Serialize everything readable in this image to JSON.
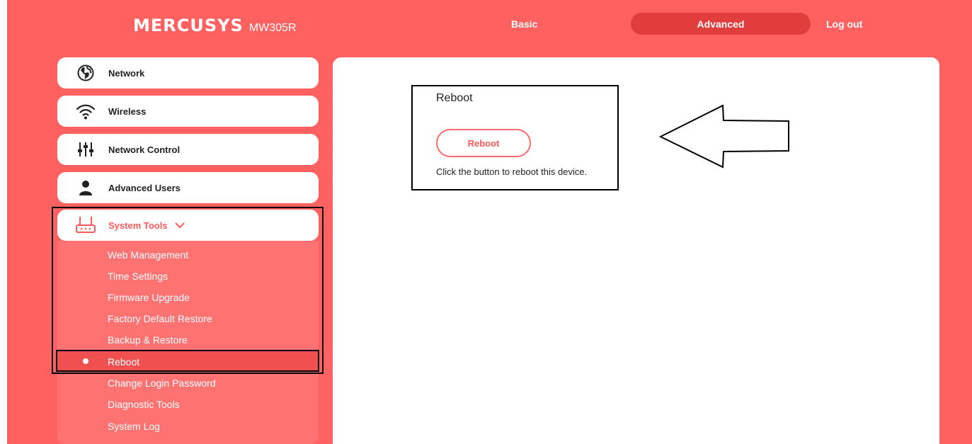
{
  "header": {
    "brand": "MERCUSYS",
    "model": "MW305R",
    "nav": {
      "basic": "Basic",
      "advanced": "Advanced",
      "logout": "Log out"
    }
  },
  "sidebar": {
    "items": [
      {
        "label": "Network",
        "icon": "globe-icon"
      },
      {
        "label": "Wireless",
        "icon": "wifi-icon"
      },
      {
        "label": "Network Control",
        "icon": "sliders-icon"
      },
      {
        "label": "Advanced Users",
        "icon": "user-icon"
      },
      {
        "label": "System Tools",
        "icon": "router-icon",
        "expanded": true
      }
    ],
    "subitems": [
      "Web Management",
      "Time Settings",
      "Firmware Upgrade",
      "Factory Default Restore",
      "Backup & Restore",
      "Reboot",
      "Change Login Password",
      "Diagnostic Tools",
      "System Log"
    ],
    "active_subitem": "Reboot"
  },
  "main": {
    "section_title": "Reboot",
    "button_label": "Reboot",
    "hint": "Click the button to reboot this device."
  },
  "colors": {
    "accent": "#ff6160",
    "active_nav": "#e23d3d",
    "sub_panel": "#ff7272",
    "button_border": "#ff6b6b"
  }
}
